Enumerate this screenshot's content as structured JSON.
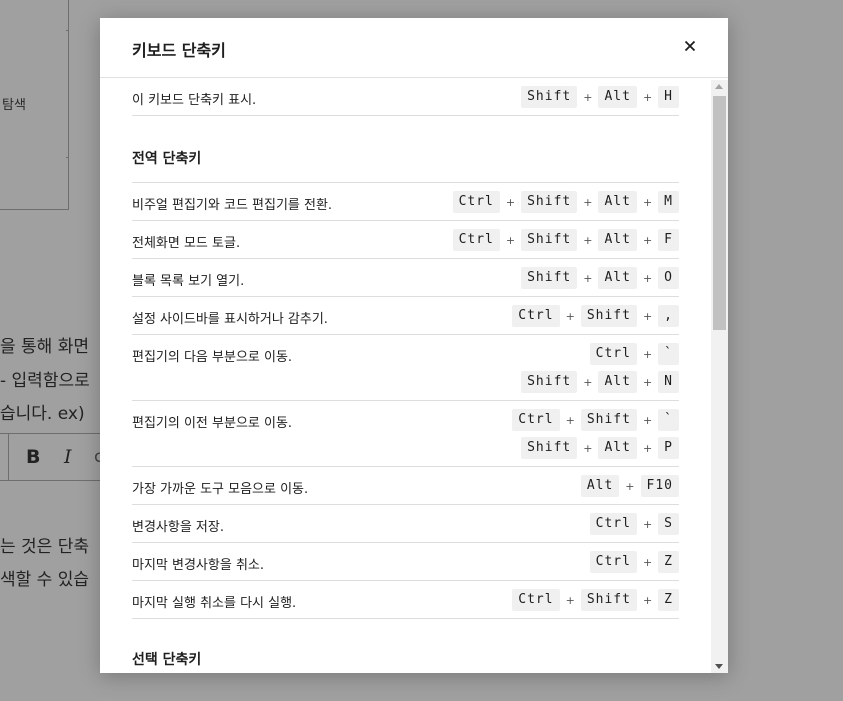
{
  "background": {
    "search_label": "탐색",
    "lines": [
      "을 통해 화면",
      "- 입력함으로",
      "습니다. ex)"
    ],
    "toolbar": {
      "bold": "B",
      "italic": "I",
      "more": "c"
    },
    "lines2": [
      "는 것은 단축",
      "색할 수 있습"
    ]
  },
  "modal": {
    "title": "키보드 단축키",
    "close_icon": "close-icon",
    "shortcuts_top": [
      {
        "desc": "이 키보드 단축키 표시.",
        "combos": [
          [
            "Shift",
            "Alt",
            "H"
          ]
        ]
      }
    ],
    "global_section": {
      "title": "전역 단축키",
      "shortcuts": [
        {
          "desc": "비주얼 편집기와 코드 편집기를 전환.",
          "combos": [
            [
              "Ctrl",
              "Shift",
              "Alt",
              "M"
            ]
          ]
        },
        {
          "desc": "전체화면 모드 토글.",
          "combos": [
            [
              "Ctrl",
              "Shift",
              "Alt",
              "F"
            ]
          ]
        },
        {
          "desc": "블록 목록 보기 열기.",
          "combos": [
            [
              "Shift",
              "Alt",
              "O"
            ]
          ]
        },
        {
          "desc": "설정 사이드바를 표시하거나 감추기.",
          "combos": [
            [
              "Ctrl",
              "Shift",
              ","
            ]
          ]
        },
        {
          "desc": "편집기의 다음 부분으로 이동.",
          "combos": [
            [
              "Ctrl",
              "`"
            ],
            [
              "Shift",
              "Alt",
              "N"
            ]
          ]
        },
        {
          "desc": "편집기의 이전 부분으로 이동.",
          "combos": [
            [
              "Ctrl",
              "Shift",
              "`"
            ],
            [
              "Shift",
              "Alt",
              "P"
            ]
          ]
        },
        {
          "desc": "가장 가까운 도구 모음으로 이동.",
          "combos": [
            [
              "Alt",
              "F10"
            ]
          ]
        },
        {
          "desc": "변경사항을 저장.",
          "combos": [
            [
              "Ctrl",
              "S"
            ]
          ]
        },
        {
          "desc": "마지막 변경사항을 취소.",
          "combos": [
            [
              "Ctrl",
              "Z"
            ]
          ]
        },
        {
          "desc": "마지막 실행 취소를 다시 실행.",
          "combos": [
            [
              "Ctrl",
              "Shift",
              "Z"
            ]
          ]
        }
      ]
    },
    "next_section_title": "선택 단축키",
    "plus_symbol": "+"
  },
  "colors": {
    "overlay": "#a0a0a0",
    "modal_bg": "#ffffff",
    "key_bg": "#f0f0f0",
    "divider": "#dddddd"
  }
}
